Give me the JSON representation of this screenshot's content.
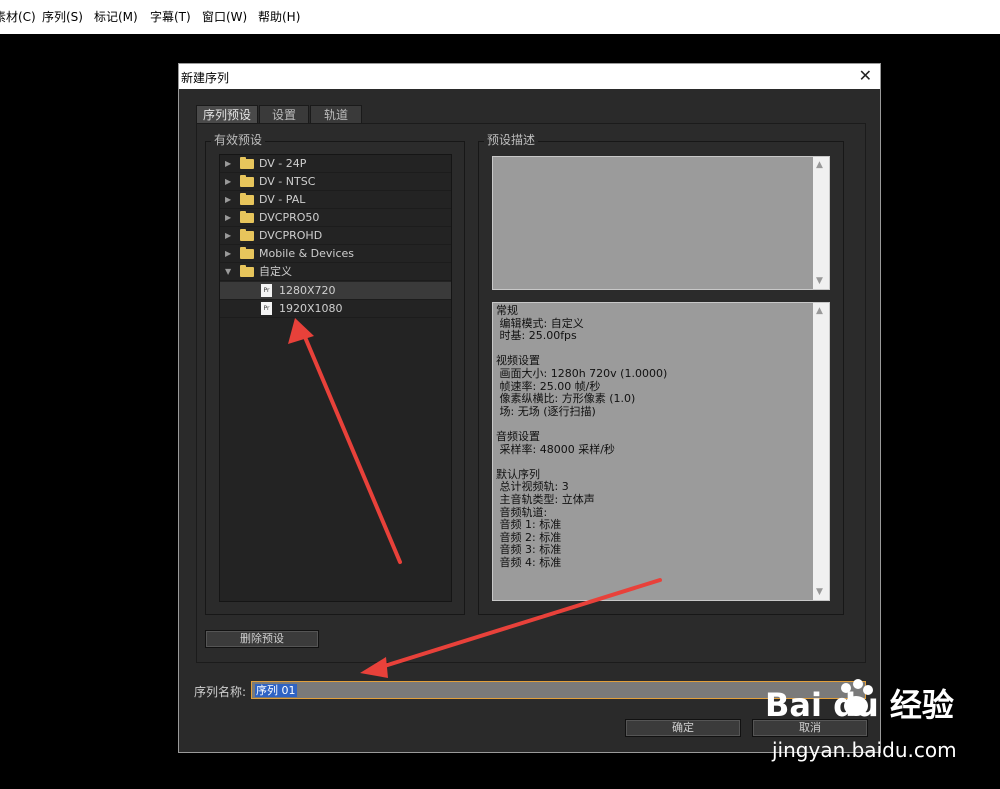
{
  "menu": {
    "items": [
      "素材(C)",
      "序列(S)",
      "标记(M)",
      "字幕(T)",
      "窗口(W)",
      "帮助(H)"
    ]
  },
  "dialog": {
    "title": "新建序列",
    "close": "✕",
    "tabs": [
      "序列预设",
      "设置",
      "轨道"
    ],
    "active_tab": "序列预设",
    "presets_legend": "有效预设",
    "description_legend": "预设描述",
    "tree": [
      {
        "label": "DV - 24P",
        "type": "folder",
        "expanded": false
      },
      {
        "label": "DV - NTSC",
        "type": "folder",
        "expanded": false
      },
      {
        "label": "DV - PAL",
        "type": "folder",
        "expanded": false
      },
      {
        "label": "DVCPRO50",
        "type": "folder",
        "expanded": false
      },
      {
        "label": "DVCPROHD",
        "type": "folder",
        "expanded": false
      },
      {
        "label": "Mobile & Devices",
        "type": "folder",
        "expanded": false
      },
      {
        "label": "自定义",
        "type": "folder",
        "expanded": true
      },
      {
        "label": "1280X720",
        "type": "file",
        "selected": true
      },
      {
        "label": "1920X1080",
        "type": "file",
        "selected": false
      }
    ],
    "file_icon_text": "Pr",
    "details": {
      "general_heading": "常规",
      "edit_mode": " 编辑模式: 自定义",
      "timebase": " 时基: 25.00fps",
      "video_heading": "视频设置",
      "frame_size": " 画面大小: 1280h 720v (1.0000)",
      "frame_rate": " 帧速率: 25.00 帧/秒",
      "pixel_aspect": " 像素纵横比: 方形像素 (1.0)",
      "fields": " 场: 无场 (逐行扫描)",
      "audio_heading": "音频设置",
      "sample_rate": " 采样率: 48000 采样/秒",
      "default_seq_heading": "默认序列",
      "total_video_tracks": " 总计视频轨: 3",
      "master_track_type": " 主音轨类型: 立体声",
      "audio_tracks_heading": " 音频轨道:",
      "audio1": " 音频 1: 标准",
      "audio2": " 音频 2: 标准",
      "audio3": " 音频 3: 标准",
      "audio4": " 音频 4: 标准"
    },
    "delete_preset_button": "删除预设",
    "sequence_name_label": "序列名称:",
    "sequence_name_value": "序列 01",
    "ok_button": "确定",
    "cancel_button": "取消"
  },
  "watermark": {
    "brand": "Bai du 经验",
    "url": "jingyan.baidu.com"
  },
  "colors": {
    "annotation_arrow": "#e8413a",
    "folder": "#e7c55c",
    "selection": "#2f63c4",
    "focus_border": "#e2a03c"
  }
}
